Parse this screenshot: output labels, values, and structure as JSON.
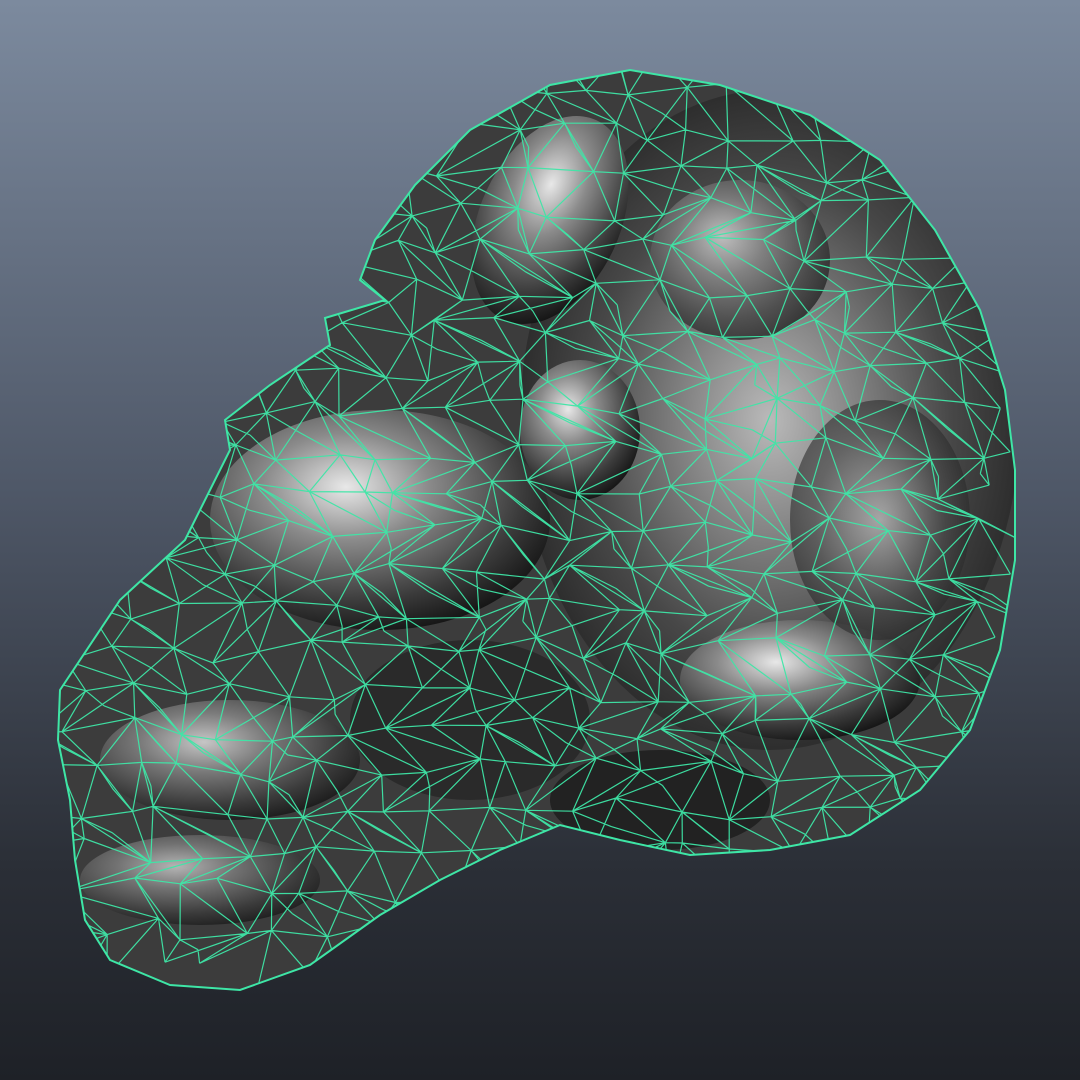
{
  "viewport": {
    "background_top": "#7c8a9e",
    "background_bottom": "#1e2127",
    "wireframe_color": "#3ee6a6",
    "shading": "smooth-shaded-with-wireframe-on-shaded",
    "object_selected": true
  },
  "model": {
    "icon": "dragon-head-mesh-icon"
  }
}
